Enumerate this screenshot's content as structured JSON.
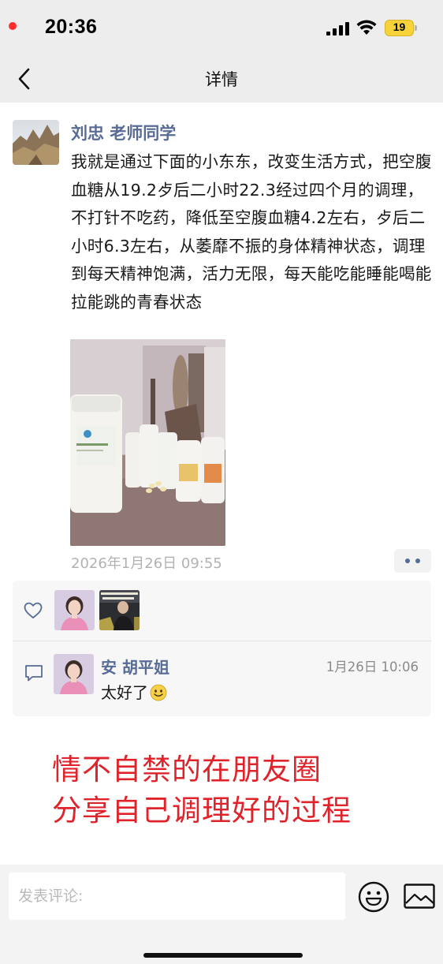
{
  "status_bar": {
    "time": "20:36",
    "battery": "19"
  },
  "nav": {
    "title": "详情"
  },
  "post": {
    "author": "刘忠 老师同学",
    "text": "我就是通过下面的小东东，改变生活方式，把空腹血糖从19.2歺后二小时22.3经过四个月的调理，不打针不吃药，降低至空腹血糖4.2左右，歺后二小时6.3左右，从萎靡不振的身体精神状态，调理到每天精神饱满，活力无限，每天能吃能睡能喝能拉能跳的青春状态",
    "time": "2026年1月26日 09:55"
  },
  "comment": {
    "name": "安 胡平姐",
    "time": "1月26日 10:06",
    "text": "太好了"
  },
  "overlay": {
    "line1": "情不自禁的在朋友圈",
    "line2": "分享自己调理好的过程"
  },
  "input": {
    "placeholder": "发表评论:"
  },
  "icons": {
    "back": "chevron-left-icon",
    "like": "heart-outline-icon",
    "comment": "comment-bubble-icon",
    "emoji": "smiley-icon",
    "image": "image-icon"
  },
  "colors": {
    "link_name": "#576b95",
    "overlay_red": "#e0222a",
    "bar_bg": "#ededed"
  }
}
